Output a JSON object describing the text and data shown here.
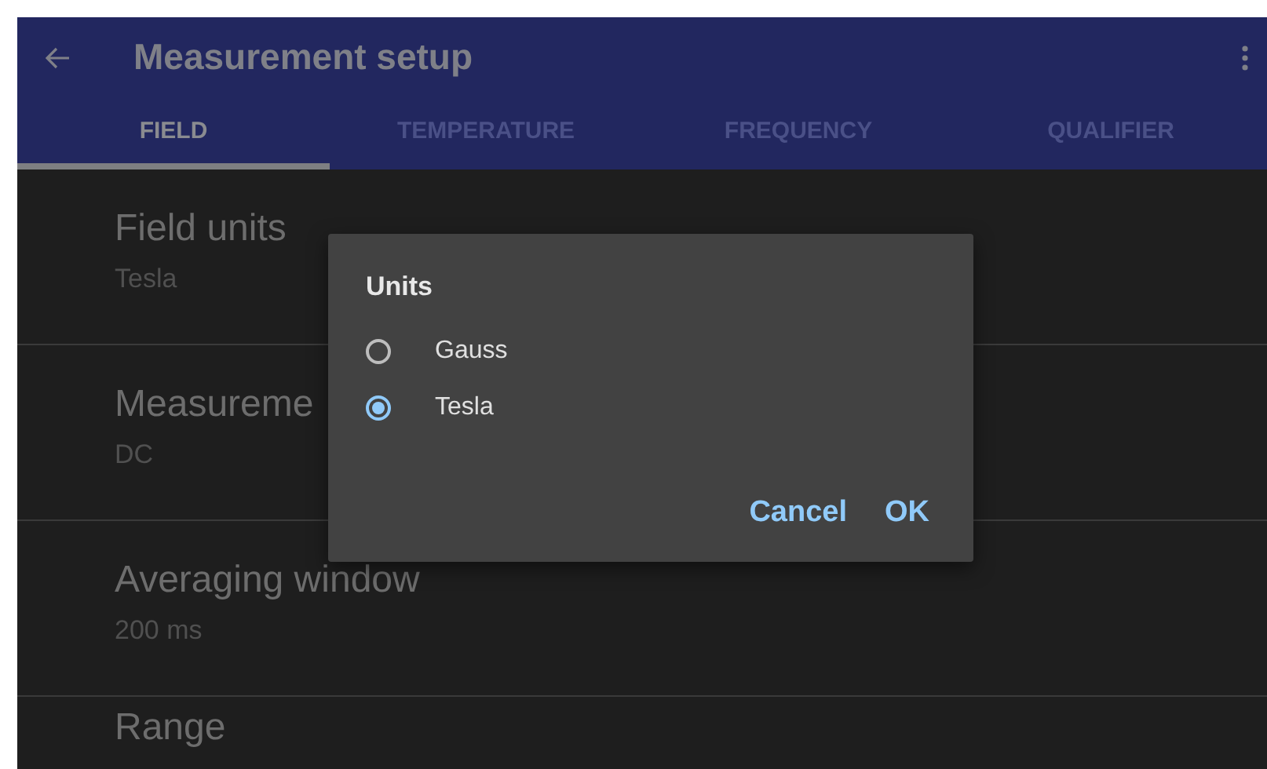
{
  "app_bar": {
    "title": "Measurement setup"
  },
  "tabs": [
    {
      "label": "FIELD",
      "selected": true
    },
    {
      "label": "TEMPERATURE",
      "selected": false
    },
    {
      "label": "FREQUENCY",
      "selected": false
    },
    {
      "label": "QUALIFIER",
      "selected": false
    }
  ],
  "settings": [
    {
      "title": "Field units",
      "value": "Tesla"
    },
    {
      "title": "Measureme",
      "value": "DC"
    },
    {
      "title": "Averaging window",
      "value": "200 ms"
    },
    {
      "title": "Range"
    }
  ],
  "dialog": {
    "title": "Units",
    "options": [
      {
        "label": "Gauss",
        "selected": false
      },
      {
        "label": "Tesla",
        "selected": true
      }
    ],
    "buttons": [
      "Cancel",
      "OK"
    ]
  }
}
